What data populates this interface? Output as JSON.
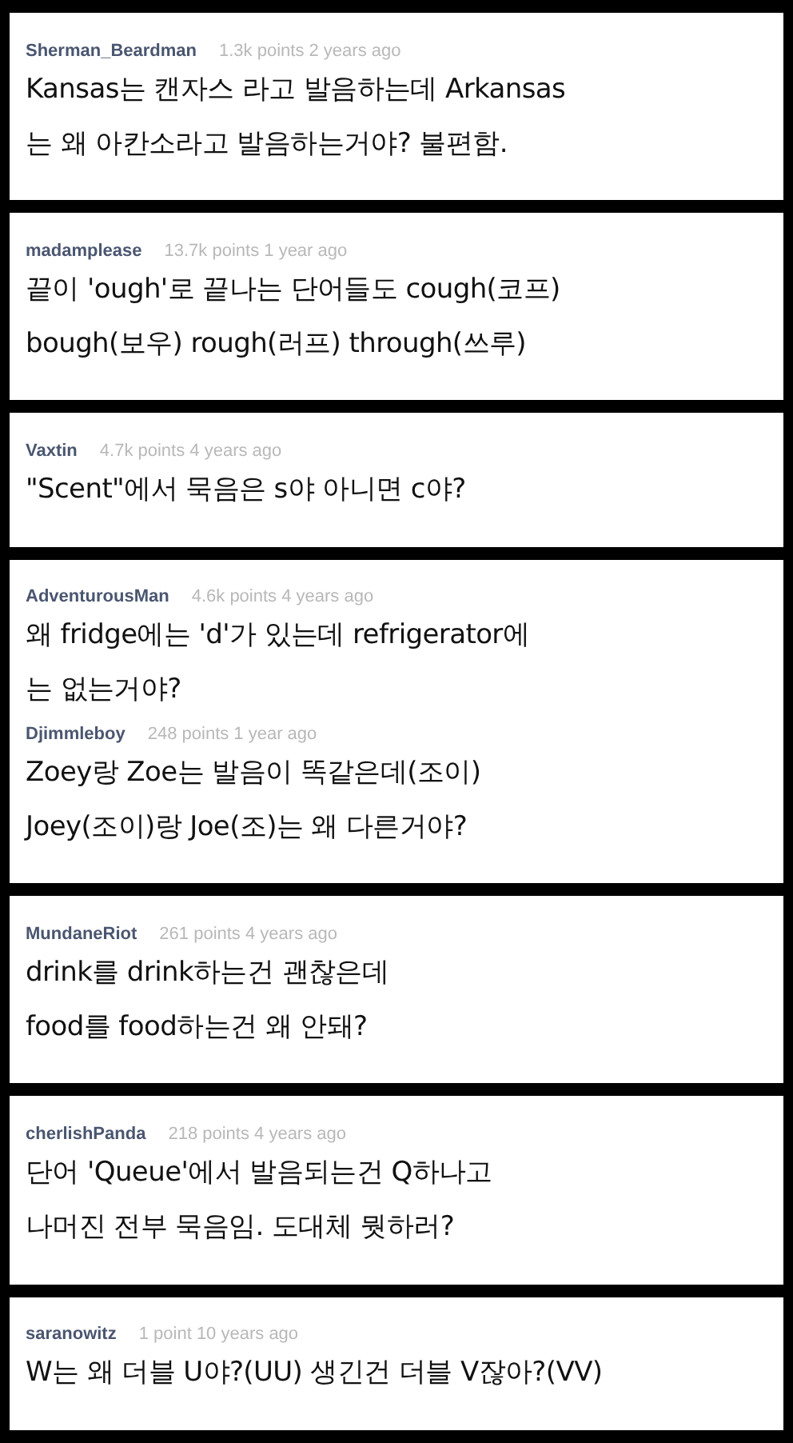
{
  "panels": [
    {
      "comments": [
        {
          "user": "Sherman_Beardman",
          "meta": "1.3k points 2 years ago",
          "lines": [
            "Kansas는 캔자스 라고 발음하는데 Arkansas",
            "는 왜 아칸소라고 발음하는거야? 불편함."
          ]
        }
      ]
    },
    {
      "comments": [
        {
          "user": "madamplease",
          "meta": "13.7k points 1 year ago",
          "lines": [
            "끝이 'ough'로 끝나는 단어들도 cough(코프)",
            "bough(보우) rough(러프) through(쓰루)"
          ]
        }
      ]
    },
    {
      "comments": [
        {
          "user": "Vaxtin",
          "meta": "4.7k points 4 years ago",
          "lines": [
            "\"Scent\"에서 묵음은 s야 아니면 c야?"
          ]
        }
      ]
    },
    {
      "comments": [
        {
          "user": "AdventurousMan",
          "meta": "4.6k points 4 years ago",
          "lines": [
            "왜 fridge에는 'd'가 있는데 refrigerator에",
            "는 없는거야?"
          ]
        },
        {
          "user": "Djimmleboy",
          "meta": "248 points 1 year ago",
          "lines": [
            "Zoey랑 Zoe는 발음이 똑같은데(조이)",
            "Joey(조이)랑 Joe(조)는 왜 다른거야?"
          ]
        }
      ]
    },
    {
      "comments": [
        {
          "user": "MundaneRiot",
          "meta": "261 points 4 years ago",
          "lines": [
            "drink를 drink하는건 괜찮은데",
            "food를 food하는건 왜 안돼?"
          ]
        }
      ]
    },
    {
      "comments": [
        {
          "user": "cherlishPanda",
          "meta": "218 points 4 years ago",
          "lines": [
            "단어 'Queue'에서 발음되는건 Q하나고",
            "나머진 전부 묵음임. 도대체 뭣하러?"
          ]
        }
      ]
    },
    {
      "comments": [
        {
          "user": "saranowitz",
          "meta": "1 point 10 years ago",
          "lines": [
            "W는 왜 더블 U야?(UU) 생긴건 더블 V잖아?(VV)"
          ]
        }
      ]
    }
  ]
}
